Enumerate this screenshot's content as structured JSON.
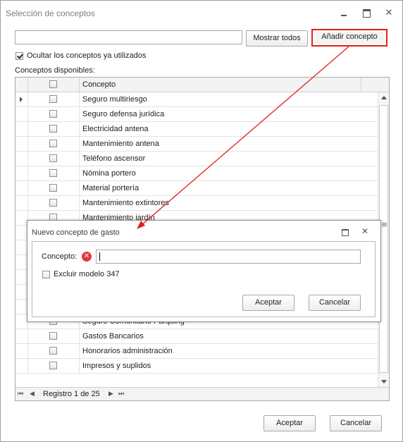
{
  "window": {
    "title": "Selección de conceptos",
    "close_glyph": "✕"
  },
  "toolbar": {
    "search_value": "",
    "show_all_label": "Mostrar todos",
    "add_concept_label": "Añadir concepto"
  },
  "options": {
    "hide_used_label": "Ocultar los conceptos ya utilizados",
    "hide_used_checked": true
  },
  "list_label": "Conceptos disponibles:",
  "grid": {
    "header": "Concepto",
    "rows_top": [
      {
        "concept": "Seguro multiriesgo",
        "checked": false,
        "current": true
      },
      {
        "concept": "Seguro defensa jurídica",
        "checked": false
      },
      {
        "concept": "Electricidad antena",
        "checked": false
      },
      {
        "concept": "Mantenimiento antena",
        "checked": false
      },
      {
        "concept": "Teléfono ascensor",
        "checked": false
      },
      {
        "concept": "Nómina portero",
        "checked": false
      },
      {
        "concept": "Material portería",
        "checked": false
      },
      {
        "concept": "Mantenimiento extintores",
        "checked": false
      },
      {
        "concept": "Mantenimiento jardín",
        "checked": false
      }
    ],
    "rows_bottom": [
      {
        "concept": "Seguro Comunitario Parquing",
        "checked": false
      },
      {
        "concept": "Gastos Bancarios",
        "checked": false
      },
      {
        "concept": "Honorarios administración",
        "checked": false
      },
      {
        "concept": "Impresos y suplidos",
        "checked": false
      }
    ]
  },
  "navigator": {
    "first": "⏮",
    "prev": "◀",
    "record_text": "Registro 1 de 25",
    "next": "▶",
    "last": "⏭"
  },
  "footer": {
    "ok_label": "Aceptar",
    "cancel_label": "Cancelar"
  },
  "dialog": {
    "title": "Nuevo concepto de gasto",
    "close_glyph": "✕",
    "concept_label": "Concepto:",
    "error_glyph": "✕",
    "concept_value": "",
    "exclude_label": "Excluir modelo 347",
    "exclude_checked": false,
    "ok_label": "Aceptar",
    "cancel_label": "Cancelar"
  },
  "colors": {
    "highlight": "#e02020",
    "error": "#e0383e"
  }
}
